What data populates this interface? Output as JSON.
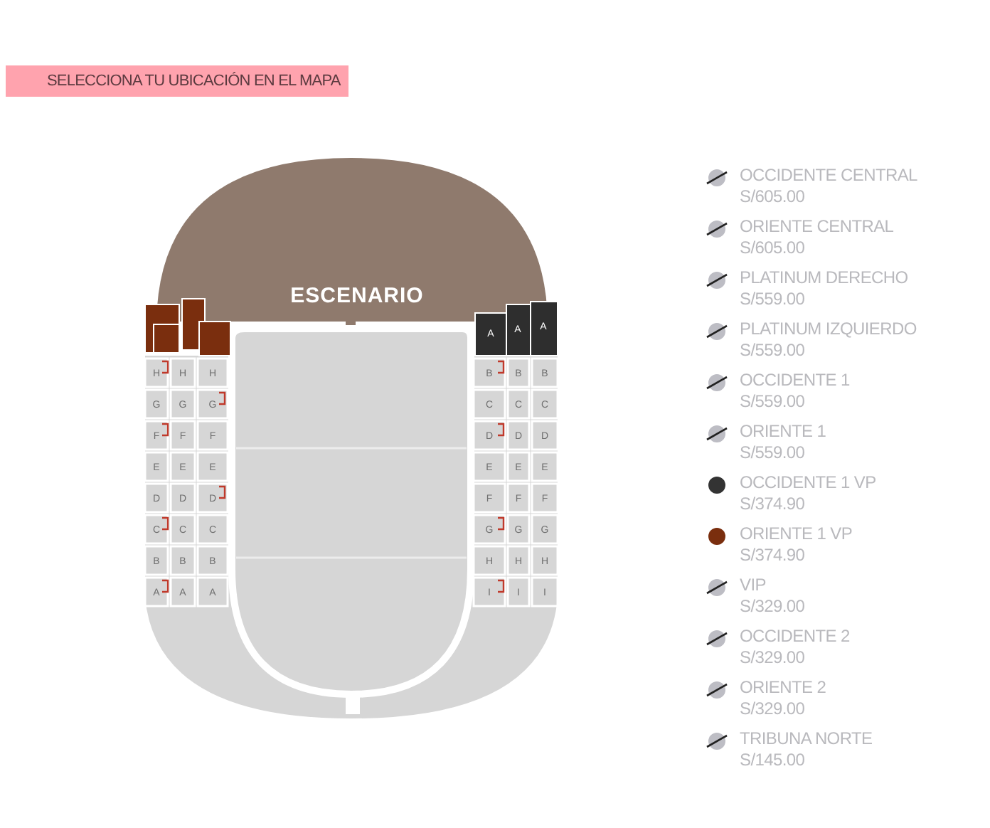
{
  "banner": {
    "text": "SELECCIONA TU UBICACIÓN EN EL MAPA"
  },
  "map": {
    "stage_label": "ESCENARIO",
    "left_rows": [
      [
        "H",
        "H",
        "H"
      ],
      [
        "G",
        "G",
        "G"
      ],
      [
        "F",
        "F",
        "F"
      ],
      [
        "E",
        "E",
        "E"
      ],
      [
        "D",
        "D",
        "D"
      ],
      [
        "C",
        "C",
        "C"
      ],
      [
        "B",
        "B",
        "B"
      ],
      [
        "A",
        "A",
        "A"
      ]
    ],
    "right_top": [
      "A",
      "A",
      "A"
    ],
    "right_rows": [
      [
        "B",
        "B",
        "B"
      ],
      [
        "C",
        "C",
        "C"
      ],
      [
        "D",
        "D",
        "D"
      ],
      [
        "E",
        "E",
        "E"
      ],
      [
        "F",
        "F",
        "F"
      ],
      [
        "G",
        "G",
        "G"
      ],
      [
        "H",
        "H",
        "H"
      ],
      [
        "I",
        "I",
        "I"
      ]
    ]
  },
  "legend": [
    {
      "kind": "soldout",
      "label": "OCCIDENTE CENTRAL",
      "price": "S/605.00"
    },
    {
      "kind": "soldout",
      "label": "ORIENTE CENTRAL",
      "price": "S/605.00"
    },
    {
      "kind": "soldout",
      "label": "PLATINUM DERECHO",
      "price": "S/559.00"
    },
    {
      "kind": "soldout",
      "label": "PLATINUM IZQUIERDO",
      "price": "S/559.00"
    },
    {
      "kind": "soldout",
      "label": "OCCIDENTE 1",
      "price": "S/559.00"
    },
    {
      "kind": "soldout",
      "label": "ORIENTE 1",
      "price": "S/559.00"
    },
    {
      "kind": "available",
      "color": "#333333",
      "label": "OCCIDENTE 1 VP",
      "price": "S/374.90"
    },
    {
      "kind": "available",
      "color": "#7a2e0e",
      "label": "ORIENTE 1 VP",
      "price": "S/374.90"
    },
    {
      "kind": "soldout",
      "label": "VIP",
      "price": "S/329.00"
    },
    {
      "kind": "soldout",
      "label": "OCCIDENTE 2",
      "price": "S/329.00"
    },
    {
      "kind": "soldout",
      "label": "ORIENTE 2",
      "price": "S/329.00"
    },
    {
      "kind": "soldout",
      "label": "TRIBUNA NORTE",
      "price": "S/145.00"
    }
  ]
}
